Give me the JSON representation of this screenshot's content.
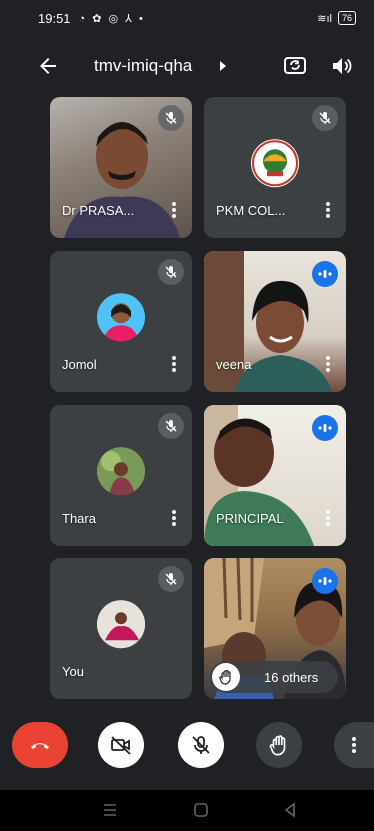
{
  "status": {
    "time": "19:51",
    "battery": "76"
  },
  "header": {
    "meeting_code": "tmv-imiq-qha"
  },
  "participants": [
    {
      "name": "Dr PRASA...",
      "state": "muted"
    },
    {
      "name": "PKM COL...",
      "state": "muted"
    },
    {
      "name": "Jomol",
      "state": "muted"
    },
    {
      "name": "veena",
      "state": "speaking"
    },
    {
      "name": "Thara",
      "state": "muted"
    },
    {
      "name": "PRINCIPAL",
      "state": "speaking"
    },
    {
      "name": "You",
      "state": "muted"
    },
    {
      "name": "16 others",
      "state": "speaking"
    }
  ],
  "controls": {
    "end_call_color": "#ea4335",
    "camera": "off",
    "mic": "off"
  },
  "icons": [
    "back-arrow-icon",
    "switch-camera-icon",
    "speaker-icon",
    "mic-off-icon",
    "speaking-indicator-icon",
    "more-vert-icon",
    "end-call-icon",
    "camera-off-icon",
    "raise-hand-icon"
  ]
}
